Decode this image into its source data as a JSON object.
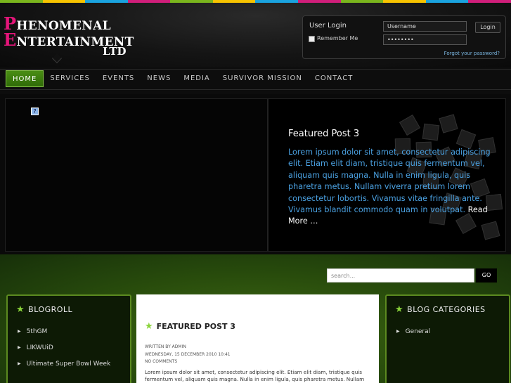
{
  "stripe_colors": [
    "#7ab51d",
    "#f7c300",
    "#1aa3df",
    "#d01e7a",
    "#7ab51d",
    "#f7c300",
    "#1aa3df",
    "#d01e7a",
    "#7ab51d",
    "#f7c300",
    "#1aa3df",
    "#d01e7a"
  ],
  "logo": {
    "line1_cap": "P",
    "line1_rest": "HENOMENAL",
    "line2_cap": "E",
    "line2_rest": "NTERTAINMENT",
    "ltd": "LTD"
  },
  "login": {
    "title": "User Login",
    "remember_label": "Remember Me",
    "username_value": "Username",
    "password_value": "••••••••",
    "button_label": "Login",
    "forgot_link": "Forgot your password?"
  },
  "nav": {
    "items": [
      "HOME",
      "SERVICES",
      "EVENTS",
      "NEWS",
      "MEDIA",
      "SURVIVOR MISSION",
      "CONTACT"
    ],
    "active": "HOME"
  },
  "feature": {
    "broken_image_glyph": "?",
    "title": "Featured Post 3",
    "body": "Lorem ipsum dolor sit amet, consectetur adipiscing elit. Etiam elit diam, tristique quis fermentum vel, aliquam quis magna. Nulla in enim ligula, quis pharetra metus. Nullam viverra pretium lorem consectetur lobortis. Vivamus vitae fringilla ante. Vivamus blandit commodo quam in volutpat.",
    "read_more": "Read More …"
  },
  "search": {
    "placeholder": "search...",
    "button_label": "GO"
  },
  "blogroll": {
    "title": "BLOGROLL",
    "items": [
      "5thGM",
      "LIKWUiD",
      "Ultimate Super Bowl Week"
    ]
  },
  "post": {
    "title": "FEATURED POST 3",
    "meta_author": "WRITTEN BY ADMIN",
    "meta_date": "WEDNESDAY, 15 DECEMBER 2010 10:41",
    "meta_comments": "NO COMMENTS",
    "body": "Lorem ipsum dolor sit amet, consectetur adipiscing elit. Etiam elit diam, tristique quis fermentum vel, aliquam quis magna. Nulla in enim ligula, quis pharetra metus. Nullam"
  },
  "categories": {
    "title": "BLOG CATEGORIES",
    "items": [
      "General"
    ]
  },
  "icons": {
    "star": "star-icon",
    "arrow": "triangle-right-icon"
  },
  "colors": {
    "accent_green": "#4a8e14",
    "feature_text_blue": "#4aa0e0",
    "logo_pink": "#e5157a"
  }
}
